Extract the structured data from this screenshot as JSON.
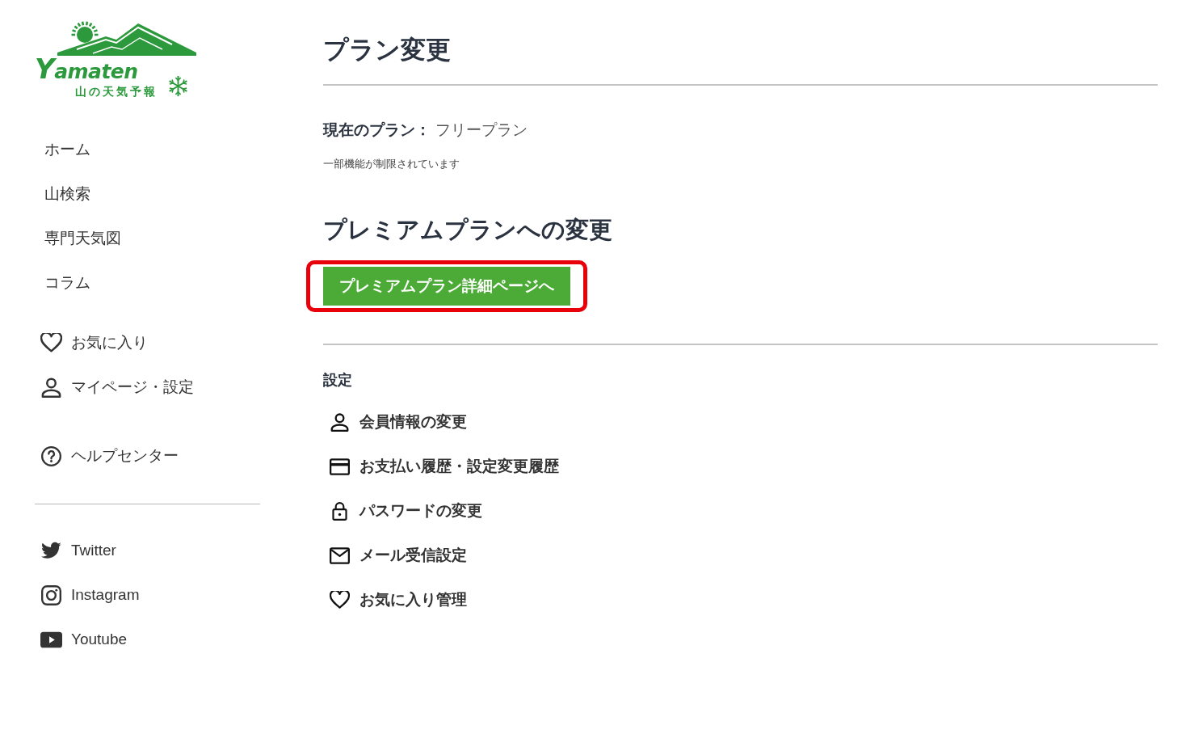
{
  "logo": {
    "wordmark": "Yamaten",
    "tagline": "山の天気予報"
  },
  "sidebar": {
    "nav_items": [
      {
        "label": "ホーム"
      },
      {
        "label": "山検索"
      },
      {
        "label": "専門天気図"
      },
      {
        "label": "コラム"
      }
    ],
    "account_items": [
      {
        "label": "お気に入り",
        "kind": "heart"
      },
      {
        "label": "マイページ・設定",
        "kind": "person"
      }
    ],
    "help_item": {
      "label": "ヘルプセンター",
      "kind": "help"
    },
    "social_links": [
      {
        "label": "Twitter",
        "kind": "twitter"
      },
      {
        "label": "Instagram",
        "kind": "instagram"
      },
      {
        "label": "Youtube",
        "kind": "youtube"
      }
    ]
  },
  "main": {
    "page_title": "プラン変更",
    "current_plan": {
      "label": "現在のプラン：",
      "value": "フリープラン",
      "note": "一部機能が制限されています"
    },
    "premium": {
      "heading": "プレミアムプランへの変更",
      "button": {
        "label": "プレミアムプラン詳細ページへ",
        "highlighted": true
      }
    },
    "settings": {
      "heading": "設定",
      "items": [
        {
          "label": "会員情報の変更",
          "kind": "person"
        },
        {
          "label": "お支払い履歴・設定変更履歴",
          "kind": "card"
        },
        {
          "label": "パスワードの変更",
          "kind": "lock"
        },
        {
          "label": "メール受信設定",
          "kind": "mail"
        },
        {
          "label": "お気に入り管理",
          "kind": "heart"
        }
      ]
    }
  }
}
